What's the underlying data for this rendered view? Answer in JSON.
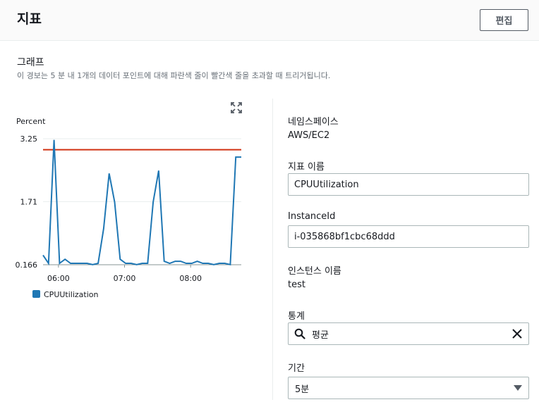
{
  "header": {
    "title": "지표",
    "edit_label": "편집"
  },
  "graph": {
    "title": "그래프",
    "description": "이 경보는 5 분 내 1개의 데이터 포인트에 대해 파란색 줄이 빨간색 줄을 초과할 때 트리거됩니다."
  },
  "chart_data": {
    "type": "line",
    "ylabel": "Percent",
    "ylim": [
      0.166,
      3.25
    ],
    "y_ticks": [
      "3.25",
      "1.71",
      "0.166"
    ],
    "x_ticks": [
      "06:00",
      "07:00",
      "08:00"
    ],
    "x_start_minute": 0,
    "x": [
      "05:46",
      "05:51",
      "05:56",
      "06:01",
      "06:06",
      "06:11",
      "06:16",
      "06:21",
      "06:26",
      "06:31",
      "06:36",
      "06:41",
      "06:46",
      "06:51",
      "06:56",
      "07:01",
      "07:06",
      "07:11",
      "07:16",
      "07:21",
      "07:26",
      "07:31",
      "07:36",
      "07:41",
      "07:46",
      "07:51",
      "07:56",
      "08:01",
      "08:06",
      "08:11",
      "08:16",
      "08:21",
      "08:26",
      "08:31",
      "08:36",
      "08:41",
      "08:46"
    ],
    "series": [
      {
        "name": "CPUUtilization",
        "color": "#1f77b4",
        "values": [
          0.4,
          0.2,
          3.22,
          0.2,
          0.3,
          0.2,
          0.2,
          0.2,
          0.2,
          0.17,
          0.2,
          1.05,
          2.4,
          1.7,
          0.3,
          0.2,
          0.2,
          0.17,
          0.2,
          0.2,
          1.7,
          2.47,
          0.25,
          0.2,
          0.25,
          0.25,
          0.2,
          0.2,
          0.25,
          0.2,
          0.2,
          0.17,
          0.2,
          0.2,
          0.17,
          2.8,
          2.8
        ]
      }
    ],
    "threshold": {
      "value": 2.98,
      "color": "#d13212"
    },
    "legend": "bottom-left",
    "grid": true
  },
  "details": {
    "namespace_label": "네임스페이스",
    "namespace_value": "AWS/EC2",
    "metric_name_label": "지표 이름",
    "metric_name_value": "CPUUtilization",
    "instance_id_label": "InstanceId",
    "instance_id_value": "i-035868bf1cbc68ddd",
    "instance_name_label": "인스턴스 이름",
    "instance_name_value": "test",
    "statistic_label": "통계",
    "statistic_value": "평균",
    "period_label": "기간",
    "period_value": "5분"
  },
  "icons": {
    "expand": "expand-icon",
    "search": "search-icon",
    "clear": "close-icon",
    "caret": "caret-down-icon"
  }
}
